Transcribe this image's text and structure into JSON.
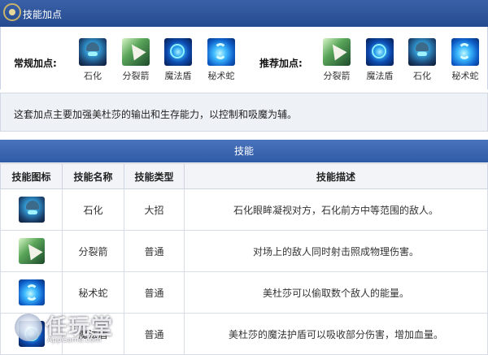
{
  "header": {
    "title": "技能加点"
  },
  "skill_points": {
    "normal_label": "常规加点:",
    "recommended_label": "推荐加点:",
    "normal": [
      {
        "name": "石化",
        "icon": "stone-gaze-icon"
      },
      {
        "name": "分裂箭",
        "icon": "split-arrow-icon"
      },
      {
        "name": "魔法盾",
        "icon": "mana-shield-icon"
      },
      {
        "name": "秘术蛇",
        "icon": "mystic-snake-icon"
      }
    ],
    "recommended": [
      {
        "name": "分裂箭",
        "icon": "split-arrow-icon"
      },
      {
        "name": "魔法盾",
        "icon": "mana-shield-icon"
      },
      {
        "name": "石化",
        "icon": "stone-gaze-icon"
      },
      {
        "name": "秘术蛇",
        "icon": "mystic-snake-icon"
      }
    ]
  },
  "description": "这套加点主要加强美杜莎的输出和生存能力，以控制和吸魔为辅。",
  "skills_table": {
    "title": "技能",
    "headers": [
      "技能图标",
      "技能名称",
      "技能类型",
      "技能描述"
    ],
    "rows": [
      {
        "name": "石化",
        "type": "大招",
        "desc": "石化眼眸凝视对方，石化前方中等范围的敌人。",
        "icon": "stone-gaze-icon"
      },
      {
        "name": "分裂箭",
        "type": "普通",
        "desc": "对场上的敌人同时射击照成物理伤害。",
        "icon": "split-arrow-icon"
      },
      {
        "name": "秘术蛇",
        "type": "普通",
        "desc": "美杜莎可以偷取数个敌人的能量。",
        "icon": "mystic-snake-icon"
      },
      {
        "name": "魔法盾",
        "type": "普通",
        "desc": "美杜莎的魔法护盾可以吸收部分伤害，增加血量。",
        "icon": "mana-shield-icon"
      }
    ]
  },
  "watermark": {
    "brand": "任玩堂",
    "site": "AppGame.com"
  },
  "colors": {
    "header_blue": "#2f5aa5",
    "desc_bg": "#eef1f6"
  }
}
